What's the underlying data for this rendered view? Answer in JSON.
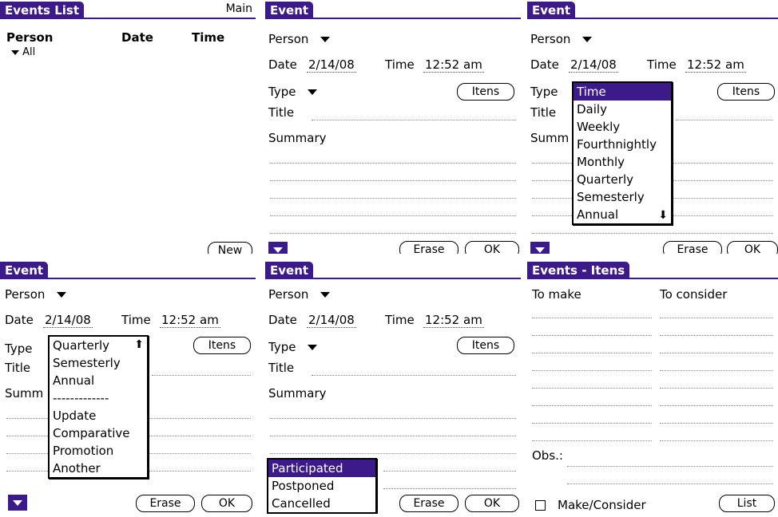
{
  "p1": {
    "title": "Events List",
    "menu": "Main",
    "cols": [
      "Person",
      "Date",
      "Time"
    ],
    "filter": "All",
    "new_btn": "New"
  },
  "event": {
    "title": "Event",
    "person": "Person",
    "date_label": "Date",
    "date": "2/14/08",
    "time_label": "Time",
    "time": "12:52 am",
    "type_label": "Type",
    "title_label": "Title",
    "summary_label": "Summary",
    "summary_short": "Summ",
    "itens_btn": "Itens",
    "erase_btn": "Erase",
    "ok_btn": "OK"
  },
  "p3": {
    "options": [
      "Time",
      "Daily",
      "Weekly",
      "Fourthnightly",
      "Monthly",
      "Quarterly",
      "Semesterly",
      "Annual"
    ]
  },
  "p4": {
    "options": [
      "Quarterly",
      "Semesterly",
      "Annual",
      "-------------",
      "Update",
      "Comparative",
      "Promotion",
      "Another"
    ]
  },
  "p5": {
    "options": [
      "Participated",
      "Postponed",
      "Cancelled"
    ]
  },
  "p6": {
    "title": "Events - Itens",
    "col1": "To make",
    "col2": "To consider",
    "obs": "Obs.:",
    "checkbox": "Make/Consider",
    "list_btn": "List"
  },
  "colors": {
    "accent": "#3c1a8a"
  }
}
